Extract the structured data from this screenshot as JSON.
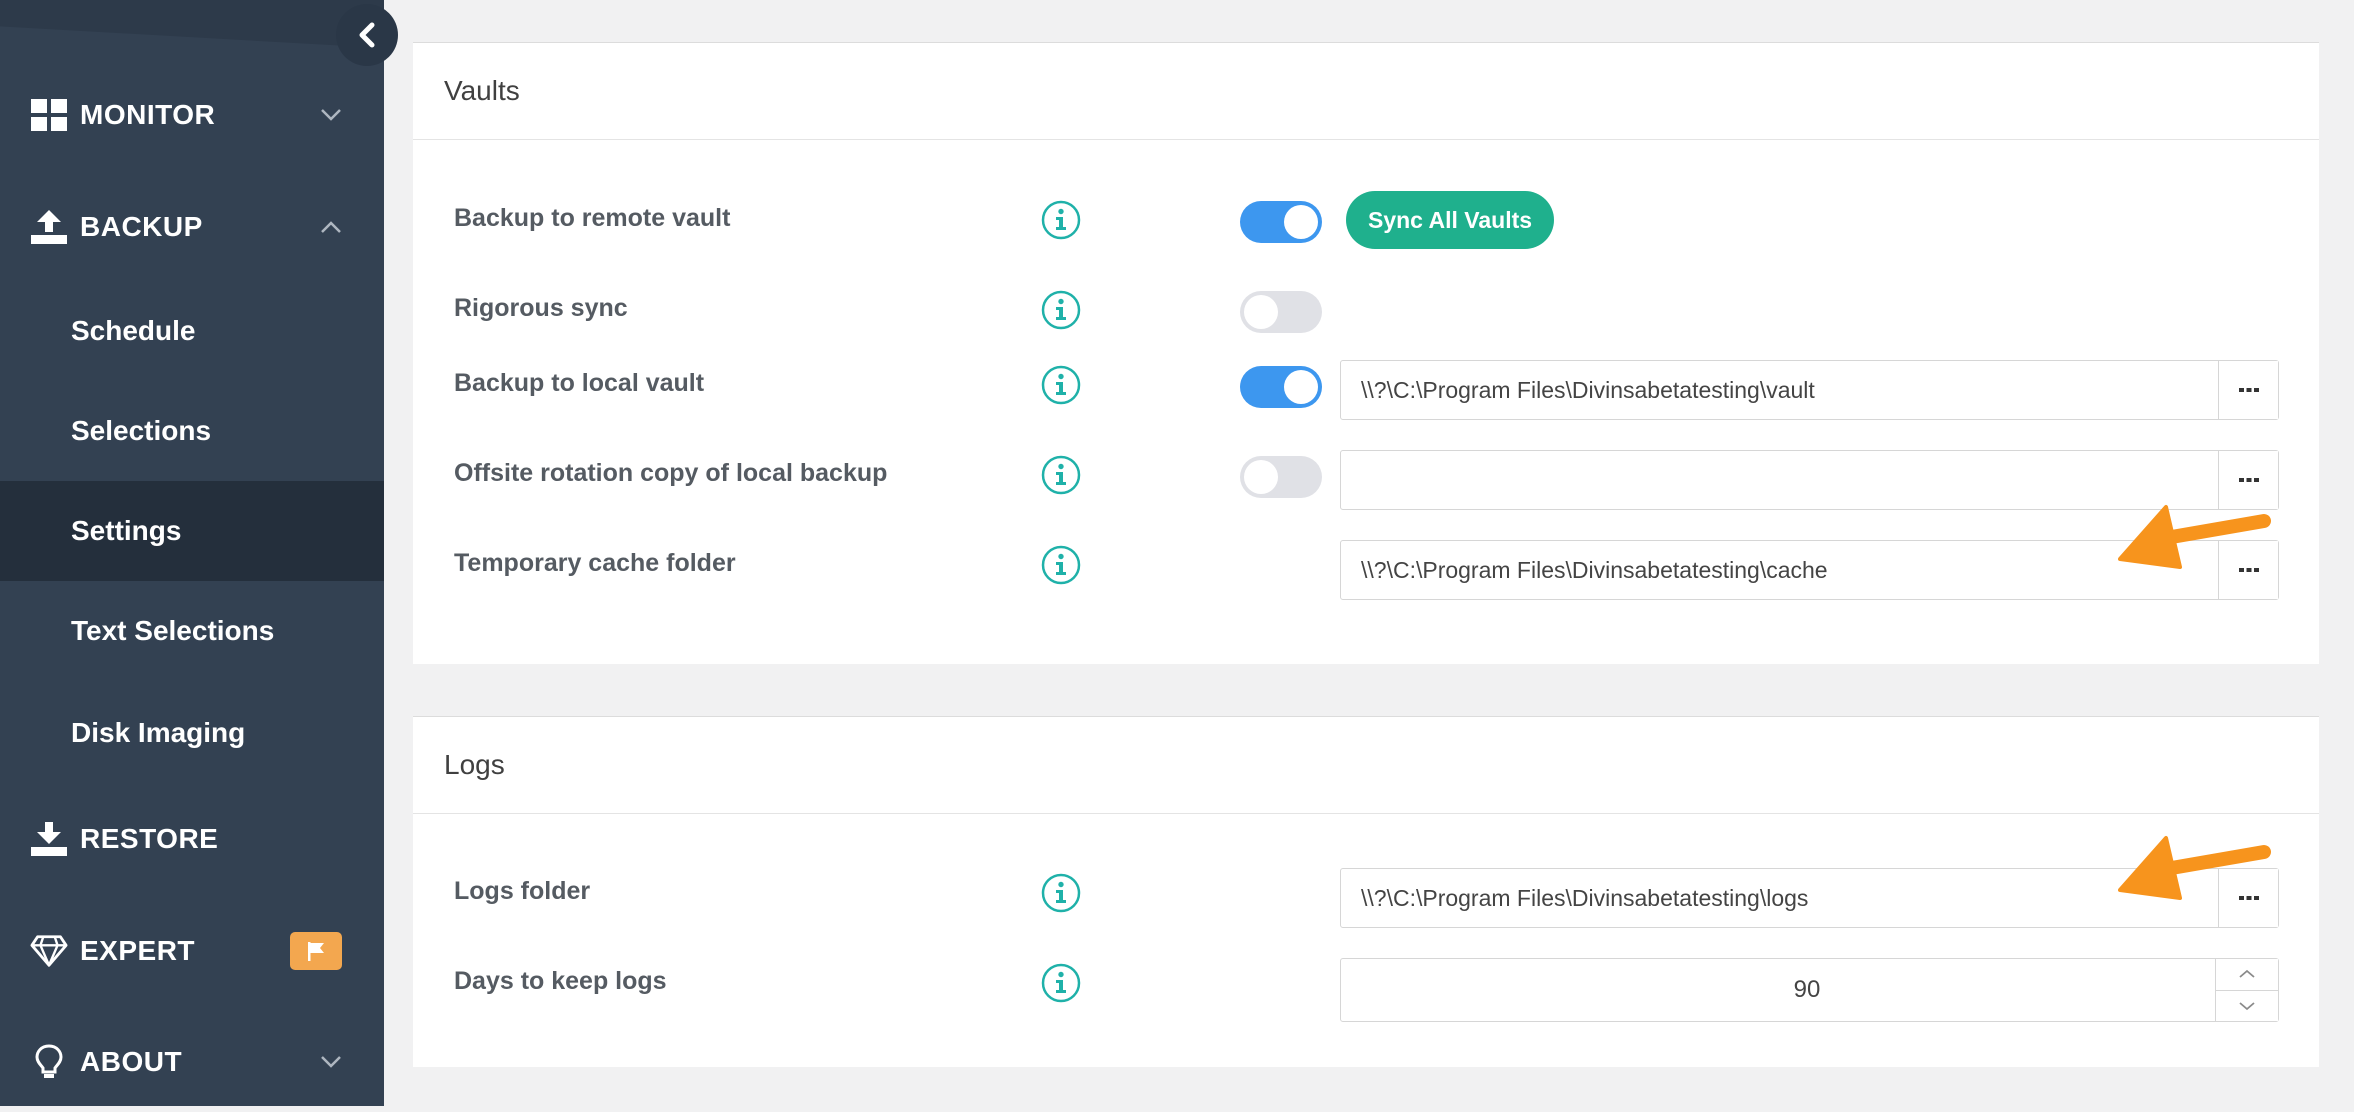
{
  "sidebar": {
    "monitor": "MONITOR",
    "backup": "BACKUP",
    "sub_items": [
      "Schedule",
      "Selections",
      "Settings",
      "Text Selections",
      "Disk Imaging"
    ],
    "active_item": "Settings",
    "restore": "RESTORE",
    "expert": "EXPERT",
    "about": "ABOUT"
  },
  "vaults": {
    "title": "Vaults",
    "remote_label": "Backup to remote vault",
    "remote_enabled": true,
    "sync_button": "Sync All Vaults",
    "rigorous_label": "Rigorous sync",
    "rigorous_enabled": false,
    "local_label": "Backup to local vault",
    "local_enabled": true,
    "local_path": "\\\\?\\C:\\Program Files\\Divinsabetatesting\\vault",
    "offsite_label": "Offsite rotation copy of local backup",
    "offsite_enabled": false,
    "offsite_path": "",
    "cache_label": "Temporary cache folder",
    "cache_path": "\\\\?\\C:\\Program Files\\Divinsabetatesting\\cache"
  },
  "logs": {
    "title": "Logs",
    "folder_label": "Logs folder",
    "folder_path": "\\\\?\\C:\\Program Files\\Divinsabetatesting\\logs",
    "days_label": "Days to keep logs",
    "days_value": "90"
  },
  "colors": {
    "sidebar_bg": "#334152",
    "sidebar_active": "#242f3c",
    "toggle_on": "#3d97ef",
    "toggle_off": "#e0e1e6",
    "sync_button": "#1fb08d",
    "info_icon": "#1fb1a9",
    "annotation_arrow": "#f7941d",
    "expert_badge": "#f3a74f"
  }
}
